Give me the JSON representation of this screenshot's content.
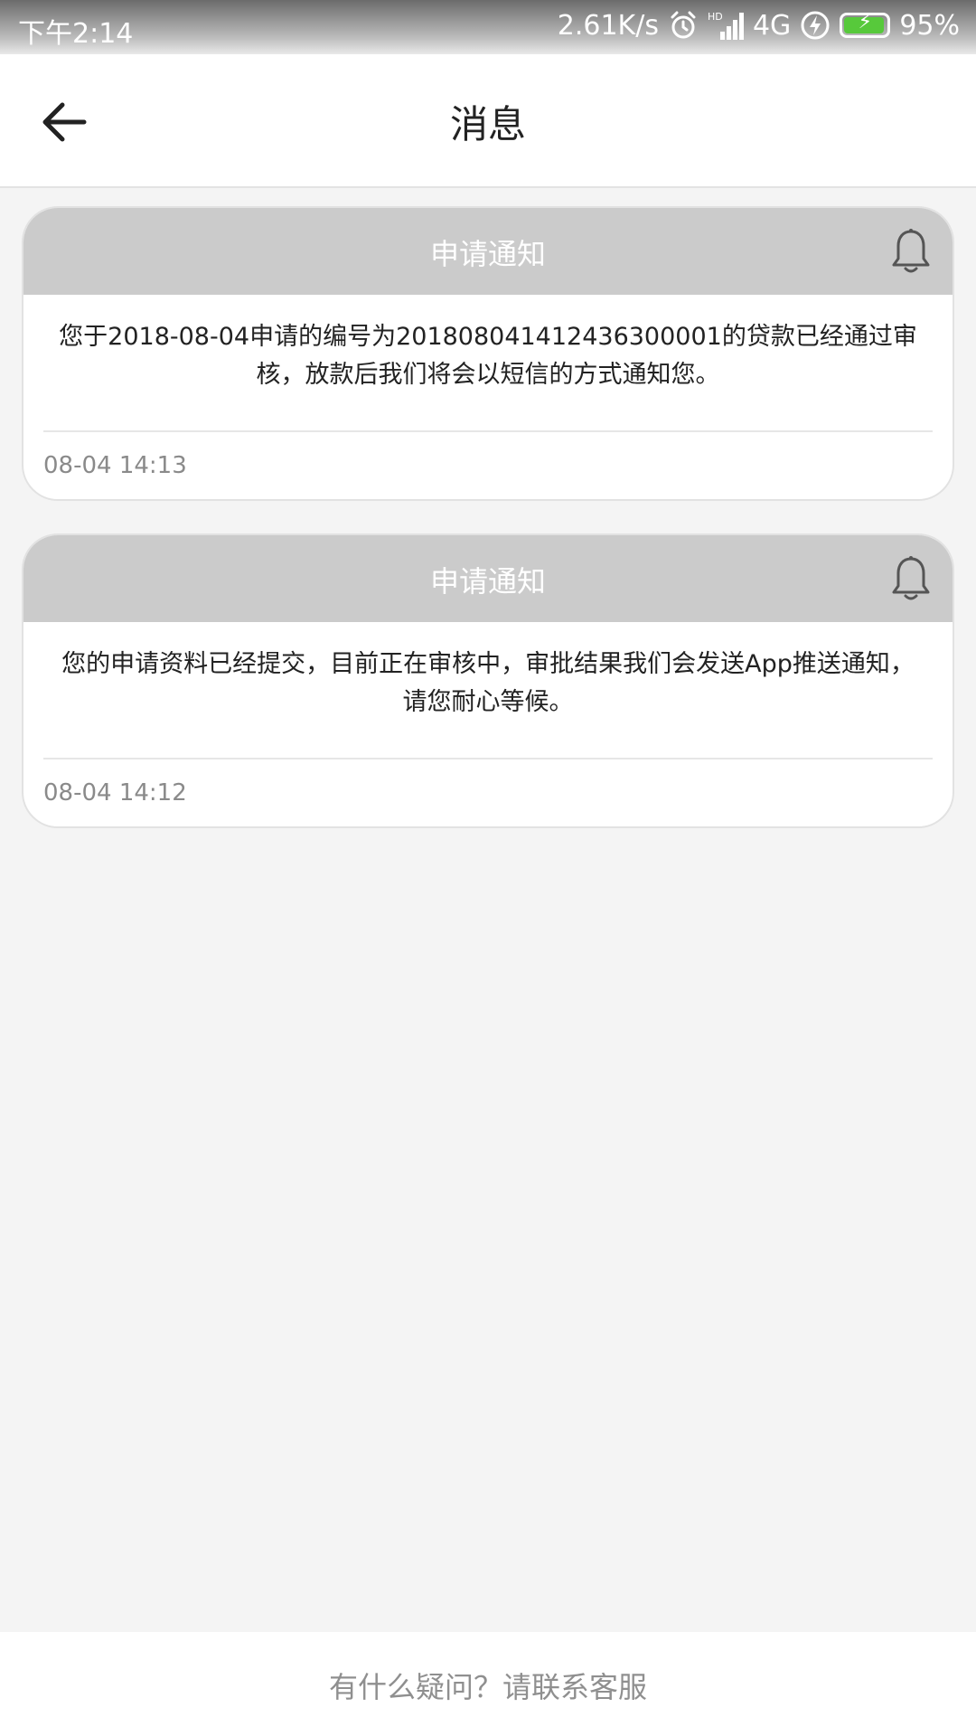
{
  "status_bar": {
    "time": "下午2:14",
    "network_speed": "2.61K/s",
    "hd_label": "HD",
    "network_type": "4G",
    "battery_percent": "95%",
    "battery_level": 0.95,
    "icons": [
      "alarm-icon",
      "signal-icon",
      "charging-icon",
      "battery-icon"
    ],
    "battery_color": "#57c93b"
  },
  "header": {
    "title": "消息",
    "back_icon": "arrow-left-icon"
  },
  "notifications": [
    {
      "title": "申请通知",
      "message": "您于2018-08-04申请的编号为201808041412436300001的贷款已经通过审核，放款后我们将会以短信的方式通知您。",
      "time": "08-04 14:13",
      "icon": "bell-icon"
    },
    {
      "title": "申请通知",
      "message": "您的申请资料已经提交，目前正在审核中，审批结果我们会发送App推送通知，请您耐心等候。",
      "time": "08-04 14:12",
      "icon": "bell-icon"
    }
  ],
  "footer": {
    "help_text": "有什么疑问？请联系客服"
  },
  "colors": {
    "background": "#f4f4f4",
    "card_header": "#cbcbcb",
    "card_title_text": "#ffffff",
    "muted_text": "#8a8a8a"
  }
}
